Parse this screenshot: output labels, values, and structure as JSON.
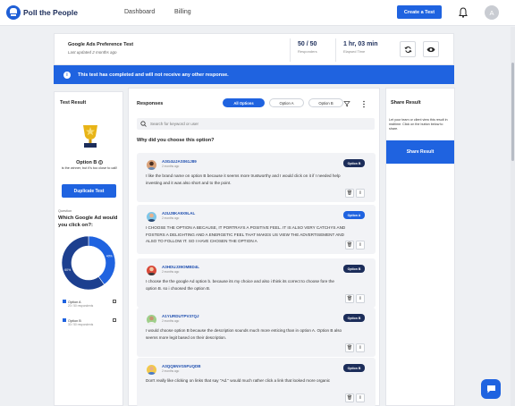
{
  "brand": {
    "name": "Poll the People"
  },
  "nav": {
    "dashboard": "Dashboard",
    "billing": "Billing",
    "create_button": "Create a Test",
    "avatar_initial": "A"
  },
  "test": {
    "title": "Google Ads Preference Test",
    "updated": "Last updated 2 months ago",
    "responders_value": "50 / 50",
    "responders_label": "Responders",
    "elapsed_value": "1 hr, 03 min",
    "elapsed_label": "Elapsed Time"
  },
  "banner": {
    "text": "This test has completed and will not receive any other response."
  },
  "left": {
    "title": "Test Result",
    "winner": "Option B",
    "winner_text": "is the winner, but it's too close to call!",
    "duplicate_button": "Duplicate Test",
    "question_label": "Question",
    "question": "Which Google Ad would you click on?:",
    "legend": [
      {
        "label": "Option A",
        "sub": "20 / 50 respondents"
      },
      {
        "label": "Option B",
        "sub": "30 / 50 respondents"
      }
    ]
  },
  "chart_data": {
    "type": "pie",
    "categories": [
      "Option A",
      "Option B"
    ],
    "values": [
      40,
      60
    ],
    "labels": [
      "40%",
      "60%"
    ],
    "colors": [
      "#1f63e0",
      "#1c3f8f"
    ]
  },
  "center": {
    "title": "Responses",
    "tabs": [
      "All Options",
      "Option A",
      "Option B"
    ],
    "search_placeholder": "Search for keyword or user",
    "question": "Why did you choose this option?",
    "responses": [
      {
        "id": "A3G4UJAS061J89",
        "time": "2 months ago",
        "option": "Option B",
        "text": "I like the brand name on option B because it seems more trustworthy and I would click on it if I needed help investing and it was also short and to the point."
      },
      {
        "id": "A2UJ8KA9X9LAL",
        "time": "2 months ago",
        "option": "Option A",
        "text": "I CHOOSE THE OPTION A BECAUSE, IT PORTRAYS A POSITIVE FEEL. IT IS ALSO VERY CATCHYS AND FOSTERS A DELIGHTING AND A ENERGETIC FEEL THAT MAKES US VIEW THE ADVERTISEMENT AND ALSO TO FOLLOW IT. SO I HAVE CHOSEN THE OPTION A"
      },
      {
        "id": "A3HDUJ39OMBD4L",
        "time": "2 months ago",
        "option": "Option B",
        "text": "I choose the the google Ad option b. because its my choice and also i think its correct to choose fore the option B. so i choosed the option B."
      },
      {
        "id": "A1YURDUTPV37QJ",
        "time": "2 months ago",
        "option": "Option B",
        "text": "I would choose option B because the description sounds much more enticing than in option A. Option B also seems more legit based on their description."
      },
      {
        "id": "A3QQ5NVG5FUQDB",
        "time": "2 months ago",
        "option": "Option B",
        "text": "Don't really like clicking on links that say \"Ad.\" would much rather click a link that looked more organic"
      }
    ]
  },
  "right": {
    "title": "Share Result",
    "text": "Let your team or client view this result in realtime. Click on the button below to share.",
    "button": "Share Result"
  },
  "colors": {
    "accent": "#1f63e0",
    "navy": "#1c2d5a"
  }
}
